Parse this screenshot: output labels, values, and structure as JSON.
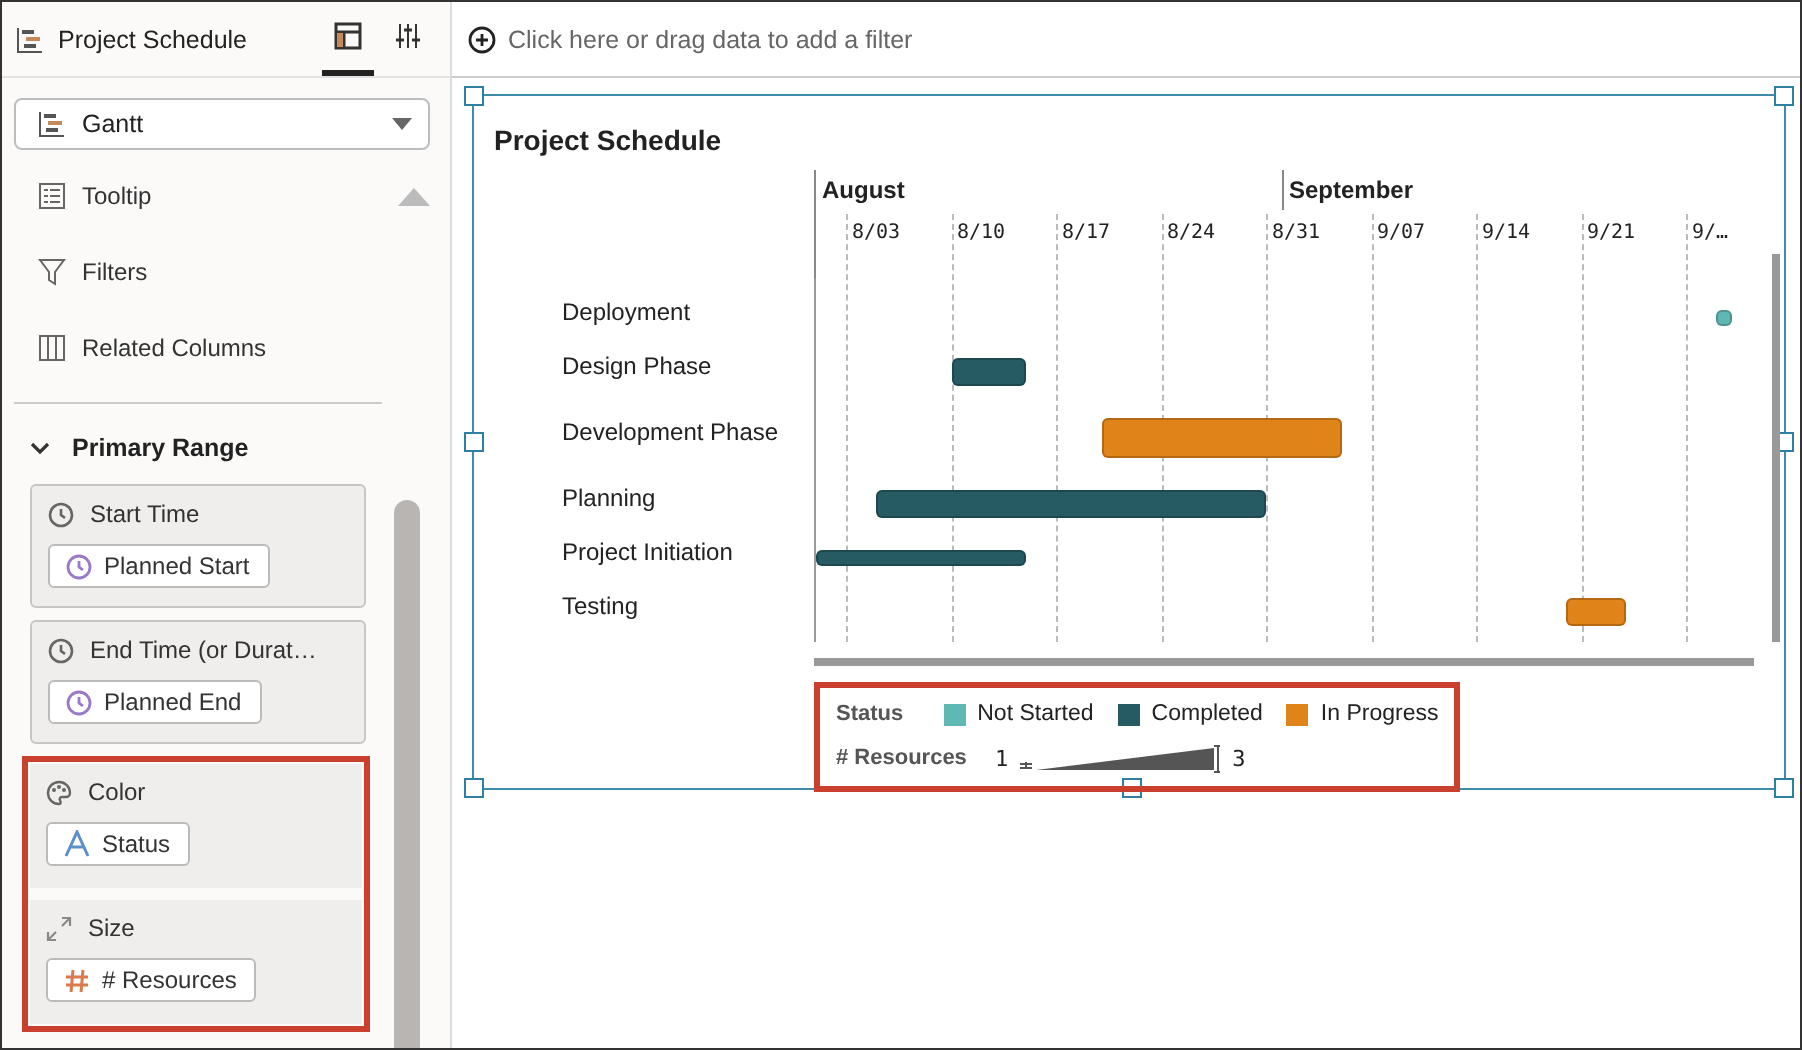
{
  "panel": {
    "title": "Project Schedule",
    "tabs": [
      {
        "kind": "grammar",
        "selected": true
      },
      {
        "kind": "properties",
        "selected": false
      }
    ],
    "chart_type": "Gantt",
    "sections": [
      {
        "kind": "tooltip",
        "label": "Tooltip"
      },
      {
        "kind": "filter",
        "label": "Filters"
      },
      {
        "kind": "columns",
        "label": "Related Columns"
      }
    ],
    "group": {
      "label": "Primary Range",
      "expanded": true
    },
    "wells": [
      {
        "kind": "time",
        "label": "Start Time",
        "field": {
          "kind": "time",
          "label": "Planned Start"
        },
        "highlighted": false
      },
      {
        "kind": "time",
        "label": "End Time (or Durat…",
        "field": {
          "kind": "time",
          "label": "Planned End"
        },
        "highlighted": false
      },
      {
        "kind": "color",
        "label": "Color",
        "field": {
          "kind": "text",
          "label": "Status"
        },
        "highlighted": true
      },
      {
        "kind": "size",
        "label": "Size",
        "field": {
          "kind": "number",
          "label": "# Resources"
        },
        "highlighted": true
      }
    ]
  },
  "filter_bar": {
    "placeholder": "Click here or drag data to add a filter"
  },
  "canvas": {
    "title": "Project Schedule",
    "months": [
      "August",
      "September"
    ],
    "ticks": [
      "8/03",
      "8/10",
      "8/17",
      "8/24",
      "8/31",
      "9/07",
      "9/14",
      "9/21",
      "9/…"
    ],
    "tasks": [
      {
        "name": "Deployment",
        "color": "#5fb8b4"
      },
      {
        "name": "Design Phase",
        "color": "#265b63"
      },
      {
        "name": "Development Phase",
        "color": "#e08318"
      },
      {
        "name": "Planning",
        "color": "#265b63"
      },
      {
        "name": "Project Initiation",
        "color": "#265b63"
      },
      {
        "name": "Testing",
        "color": "#e08318"
      }
    ],
    "legend": {
      "highlighted": true,
      "color_title": "Status",
      "items": [
        {
          "label": "Not Started",
          "color": "#5fb8b4"
        },
        {
          "label": "Completed",
          "color": "#265b63"
        },
        {
          "label": "In Progress",
          "color": "#e08318"
        }
      ],
      "size_title": "# Resources",
      "size_min": "1",
      "size_max": "3"
    }
  }
}
